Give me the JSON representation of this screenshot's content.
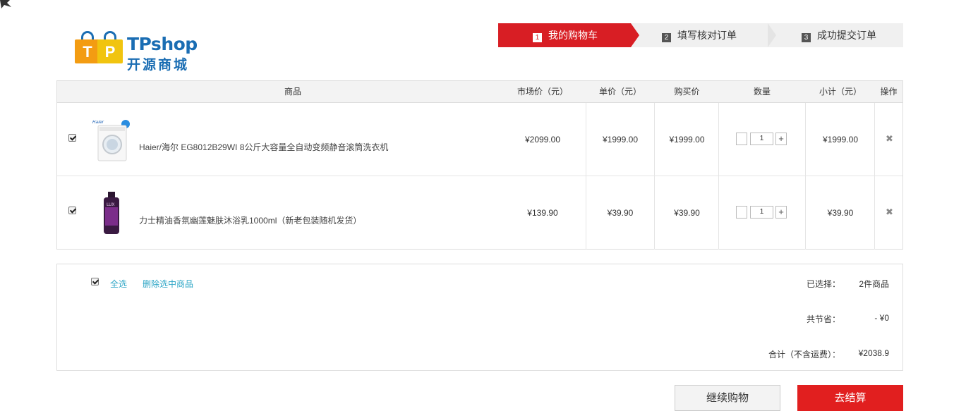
{
  "logo": {
    "brand": "TPshop",
    "subtitle": "开源商城",
    "bag_letters": [
      "T",
      "P"
    ]
  },
  "steps": [
    {
      "num": "1",
      "label": "我的购物车",
      "active": true
    },
    {
      "num": "2",
      "label": "填写核对订单",
      "active": false
    },
    {
      "num": "3",
      "label": "成功提交订单",
      "active": false
    }
  ],
  "table": {
    "headers": {
      "product": "商品",
      "market_price": "市场价（元）",
      "unit_price": "单价（元）",
      "buy_price": "购买价",
      "quantity": "数量",
      "subtotal": "小计（元）",
      "action": "操作"
    },
    "rows": [
      {
        "checked": true,
        "name": "Haier/海尔 EG8012B29WI 8公斤大容量全自动变频静音滚筒洗衣机",
        "market_price": "¥2099.00",
        "unit_price": "¥1999.00",
        "buy_price": "¥1999.00",
        "qty": "1",
        "subtotal": "¥1999.00",
        "thumb_label": "Haier",
        "delete_icon": "close-icon"
      },
      {
        "checked": true,
        "name": "力士精油香氛幽莲魅肤沐浴乳1000ml（新老包装随机发货）",
        "market_price": "¥139.90",
        "unit_price": "¥39.90",
        "buy_price": "¥39.90",
        "qty": "1",
        "subtotal": "¥39.90",
        "thumb_label": "LUX",
        "delete_icon": "close-icon"
      }
    ],
    "qty_plus": "+"
  },
  "summary": {
    "select_all": "全选",
    "delete_selected": "删除选中商品",
    "selected_label": "已选择：",
    "selected_value": "2件商品",
    "saved_label": "共节省：",
    "saved_value": "- ¥0",
    "total_label": "合计（不含运费）：",
    "total_value": "¥2038.9"
  },
  "buttons": {
    "continue": "继续购物",
    "checkout": "去结算"
  },
  "colors": {
    "accent": "#d81e24",
    "link": "#2aa4c5",
    "brand": "#1a6db3"
  }
}
